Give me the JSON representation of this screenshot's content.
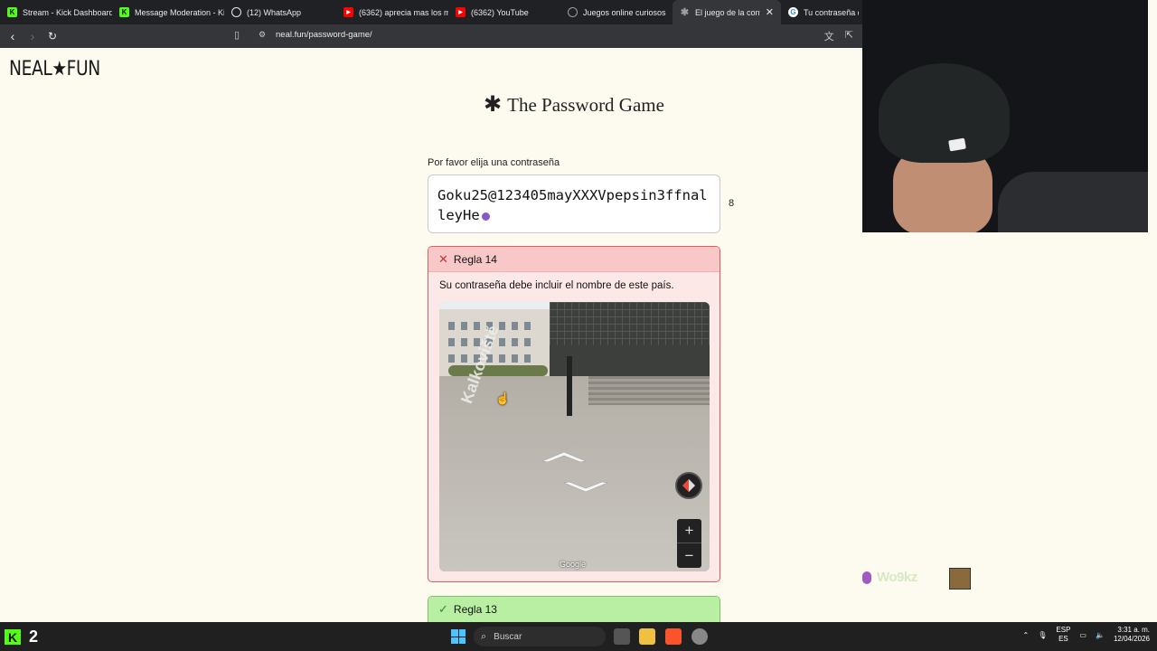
{
  "browser": {
    "tabs": [
      {
        "label": "Stream - Kick Dashboard",
        "icon": "kick-icon",
        "color": "#53fc18"
      },
      {
        "label": "Message Moderation - Ki",
        "icon": "kick-icon",
        "color": "#53fc18"
      },
      {
        "label": "(12) WhatsApp",
        "icon": "whatsapp-icon",
        "color": "#25d366"
      },
      {
        "label": "(6362) aprecia mas los m",
        "icon": "youtube-icon",
        "color": "#ff0000"
      },
      {
        "label": "(6362) YouTube",
        "icon": "youtube-icon",
        "color": "#ff0000"
      },
      {
        "label": "Juegos online curiosos",
        "icon": "page-icon",
        "color": "#9aa0a6"
      },
      {
        "label": "El juego de la contra",
        "icon": "star-icon",
        "color": "#9aa0a6",
        "active": true
      },
      {
        "label": "Tu contraseña de",
        "icon": "google-icon",
        "color": "#4285f4"
      }
    ],
    "url": "neal.fun/password-game/"
  },
  "page": {
    "logo": "NEAL★FUN",
    "title_star": "✱",
    "title": "The Password Game",
    "prompt": "Por favor elija una contraseña",
    "password": "Goku25@123405mayXXXVpepsin3ffnalleyHe",
    "char_count": "8",
    "rules": {
      "failing": {
        "mark": "✕",
        "title": "Regla 14",
        "text": "Su contraseña debe incluir el nombre de este país."
      },
      "passing": {
        "mark": "✓",
        "title": "Regla 13"
      }
    },
    "map": {
      "street_label": "Kalkoviště",
      "zoom_in": "+",
      "zoom_out": "−",
      "brand": "Google"
    }
  },
  "overlay": {
    "chat_username": "Wo9kz"
  },
  "taskbar": {
    "kick_count": "2",
    "search_placeholder": "Buscar",
    "lang_top": "ESP",
    "lang_bottom": "ES",
    "time": "3:31 a. m.",
    "date": "12/04/2026"
  }
}
